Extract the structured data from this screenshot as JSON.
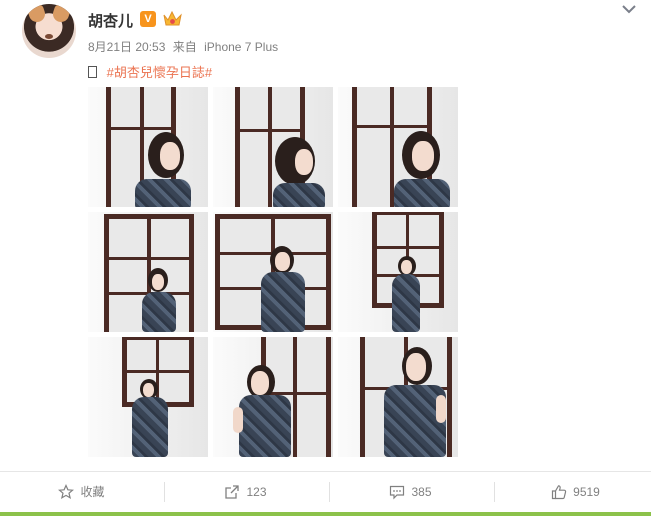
{
  "user": {
    "name": "胡杏儿",
    "badge": "V"
  },
  "meta": {
    "date": "8月21日 20:53",
    "source_prefix": "来自",
    "source": "iPhone 7 Plus"
  },
  "post": {
    "hashtag": "#胡杏兒懷孕日誌#"
  },
  "photos": [
    "photo-1",
    "photo-2",
    "photo-3",
    "photo-4",
    "photo-5",
    "photo-6",
    "photo-7",
    "photo-8",
    "photo-9"
  ],
  "actions": {
    "favorite": {
      "label": "收藏",
      "icon": "star-icon"
    },
    "repost": {
      "label": "123",
      "icon": "repost-icon"
    },
    "comment": {
      "label": "385",
      "icon": "comment-icon"
    },
    "like": {
      "label": "9519",
      "icon": "thumbs-up-icon"
    }
  },
  "colors": {
    "link": "#eb7350",
    "verified": "#f7941d",
    "meta": "#808080",
    "accent_line": "#8cc24a"
  }
}
